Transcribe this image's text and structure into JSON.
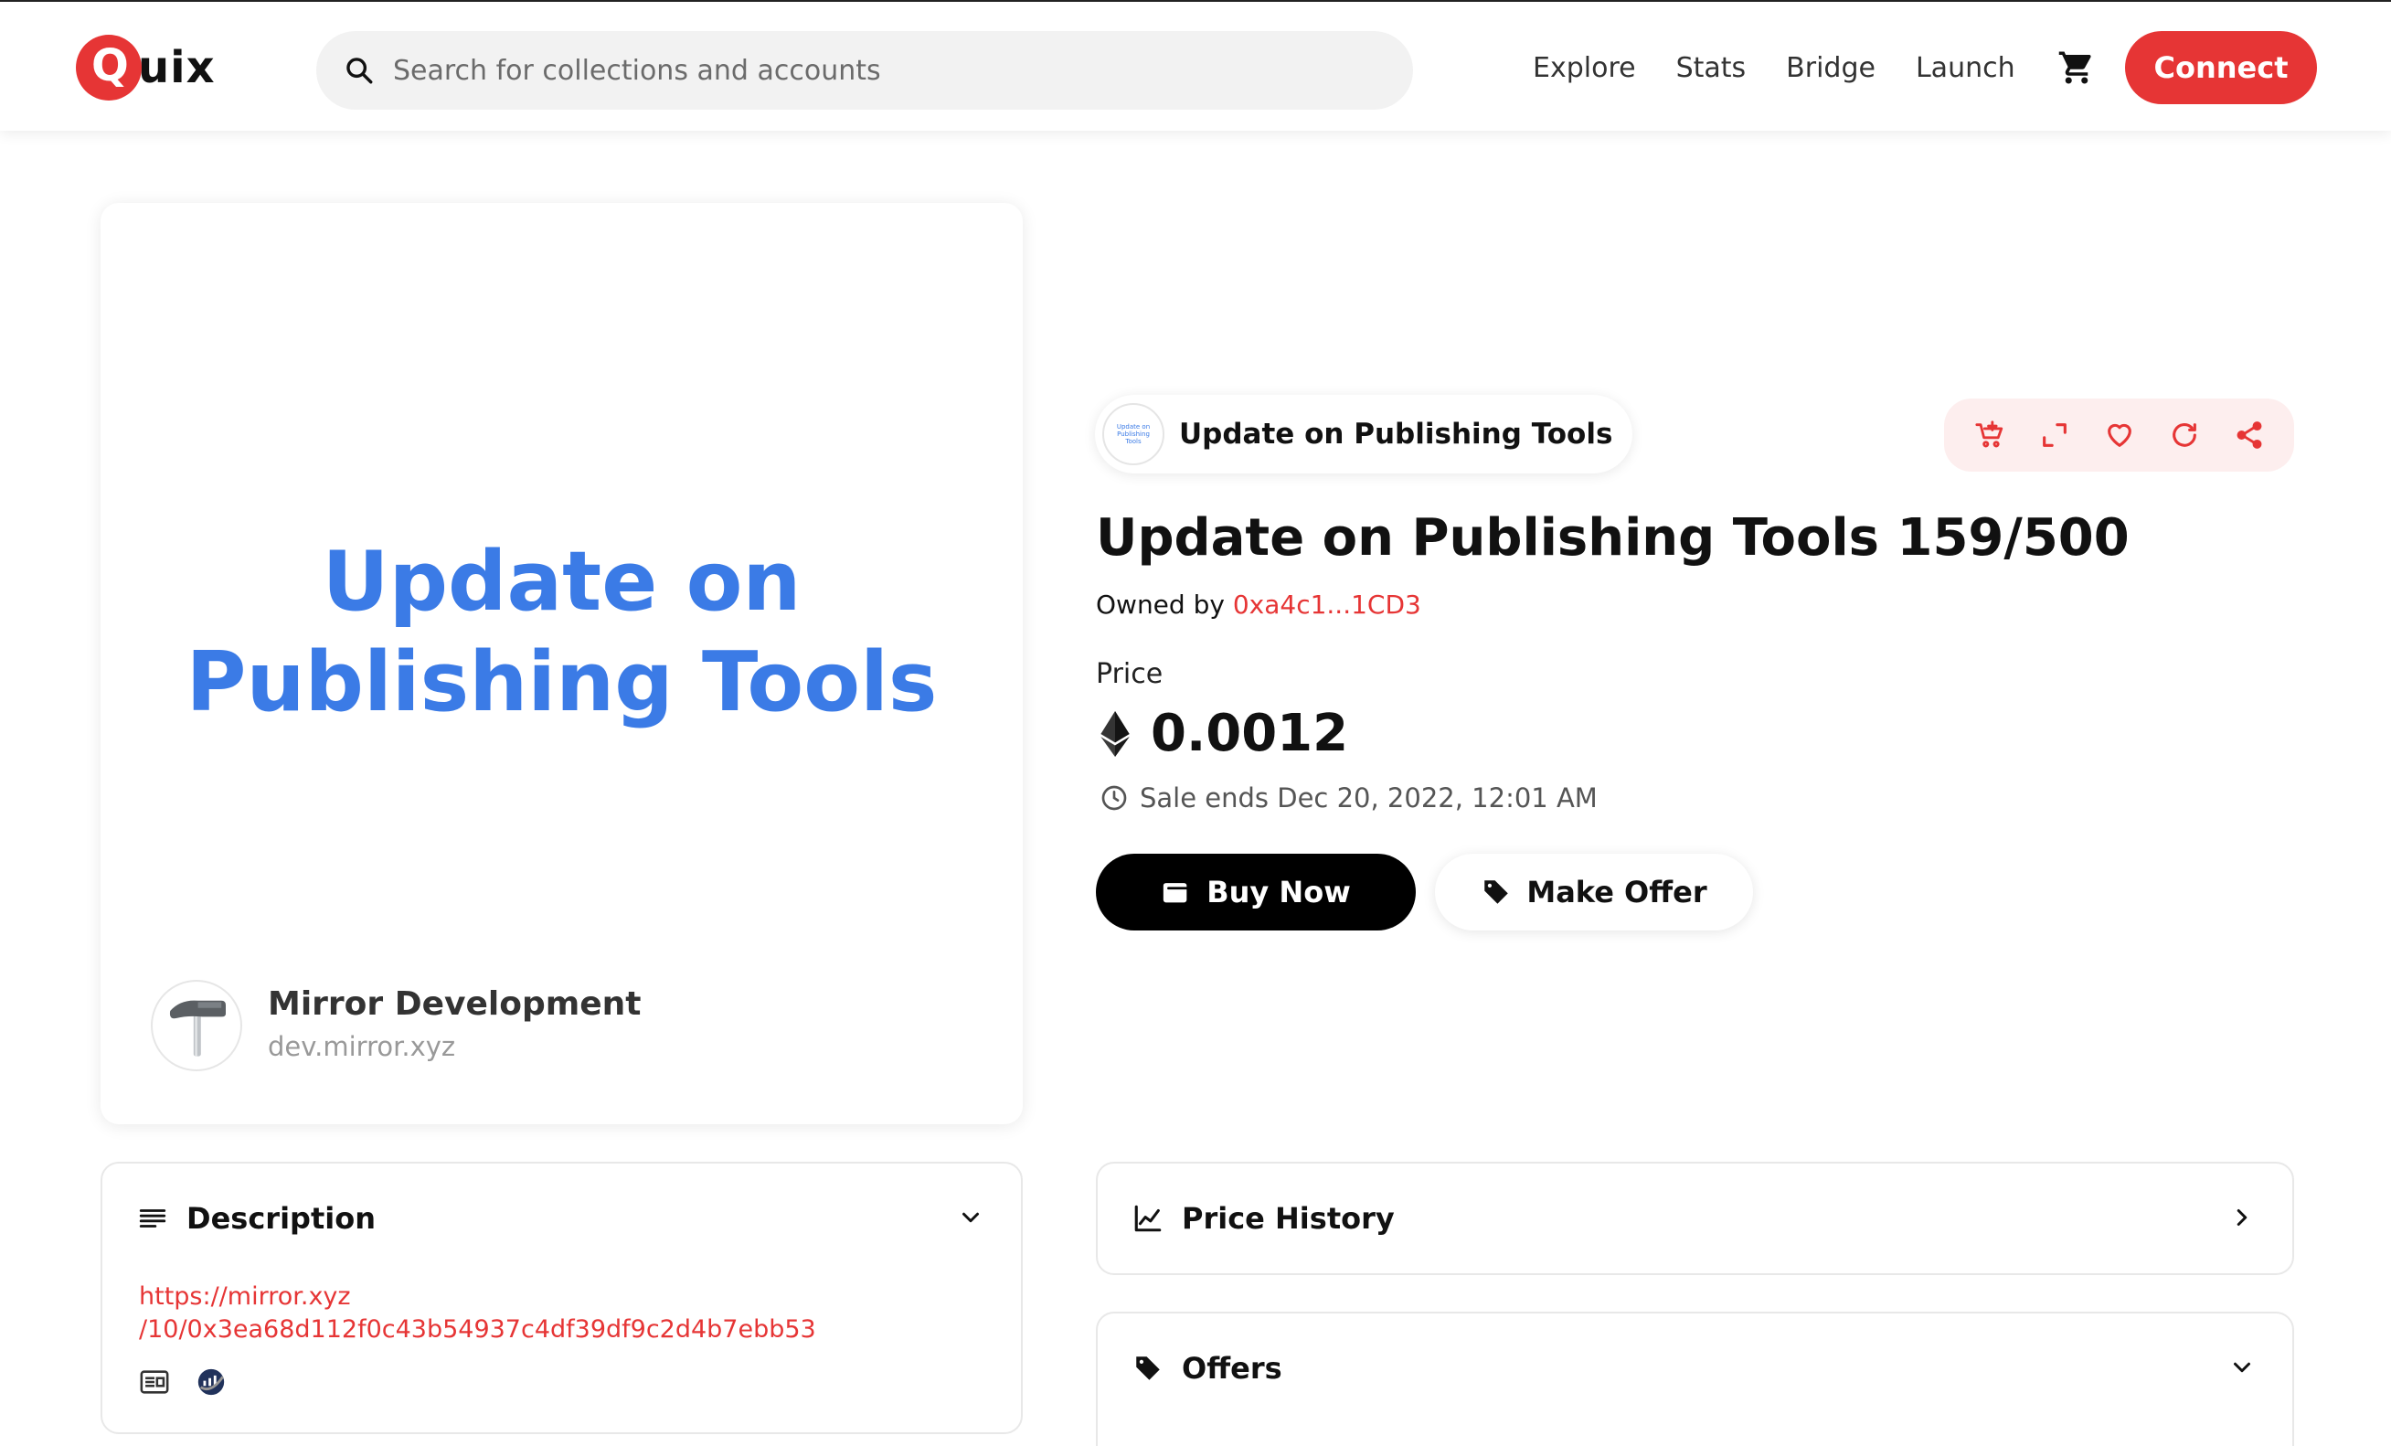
{
  "header": {
    "logo_text": "Quix",
    "search_placeholder": "Search for collections and accounts",
    "nav": [
      "Explore",
      "Stats",
      "Bridge",
      "Launch"
    ],
    "connect_label": "Connect",
    "accent_color": "#e63535"
  },
  "artwork": {
    "title": "Update on Publishing Tools",
    "publisher_name": "Mirror Development",
    "publisher_site": "dev.mirror.xyz",
    "title_color": "#3b7be6"
  },
  "item": {
    "collection_name": "Update on Publishing Tools",
    "collection_thumb_text": "Update on Publishing Tools",
    "name": "Update on Publishing Tools 159/500",
    "owned_by_label": "Owned by",
    "owner": "0xa4c1...1CD3",
    "price_label": "Price",
    "price": "0.0012",
    "sale_ends": "Sale ends Dec 20, 2022, 12:01 AM",
    "buy_label": "Buy Now",
    "offer_label": "Make Offer",
    "actions": [
      "add-to-cart-icon",
      "expand-icon",
      "heart-icon",
      "refresh-icon",
      "share-icon"
    ]
  },
  "description": {
    "title": "Description",
    "link_line1": "https://mirror.xyz",
    "link_line2": "/10/0x3ea68d112f0c43b54937c4df39df9c2d4b7ebb53"
  },
  "price_history": {
    "title": "Price History"
  },
  "offers": {
    "title": "Offers"
  }
}
